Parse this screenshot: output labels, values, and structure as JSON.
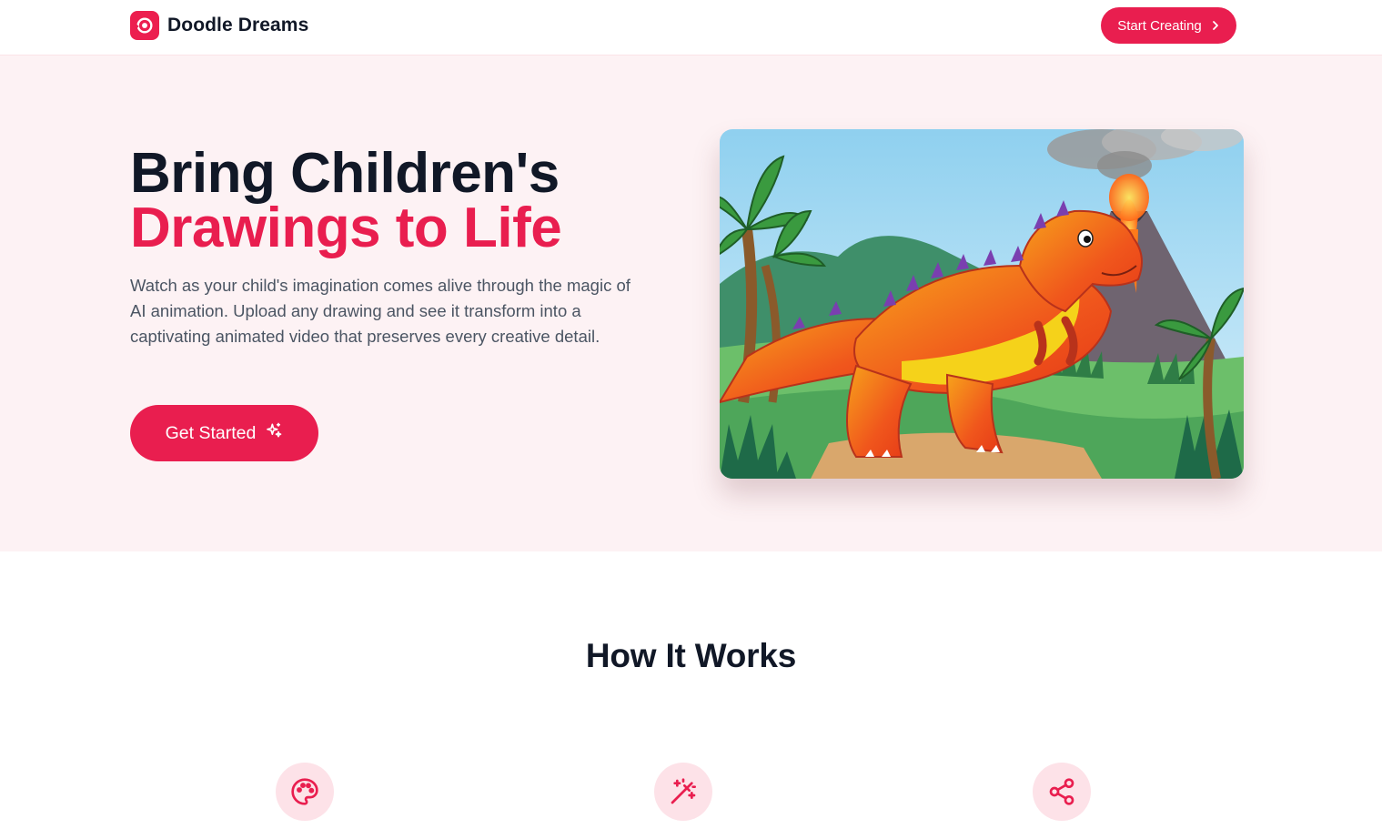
{
  "header": {
    "brand_name": "Doodle Dreams",
    "brand_icon": "doodle-logo-icon",
    "cta_label": "Start Creating",
    "cta_icon": "chevron-right-icon"
  },
  "hero": {
    "title_line1": "Bring Children's",
    "title_line2": "Drawings to Life",
    "description": "Watch as your child's imagination comes alive through the magic of AI animation. Upload any drawing and see it transform into a captivating animated video that preserves every creative detail.",
    "button_label": "Get Started",
    "button_icon": "sparkles-icon",
    "image": "dinosaur-volcano-drawing"
  },
  "how_it_works": {
    "title": "How It Works",
    "steps": [
      {
        "icon": "palette-icon"
      },
      {
        "icon": "magic-wand-icon"
      },
      {
        "icon": "share-icon"
      }
    ]
  },
  "colors": {
    "accent": "#e91e4f",
    "hero_bg": "#fdf2f4",
    "heading": "#111827",
    "body_text": "#4b5563",
    "icon_circle_bg": "#fde2e8"
  }
}
